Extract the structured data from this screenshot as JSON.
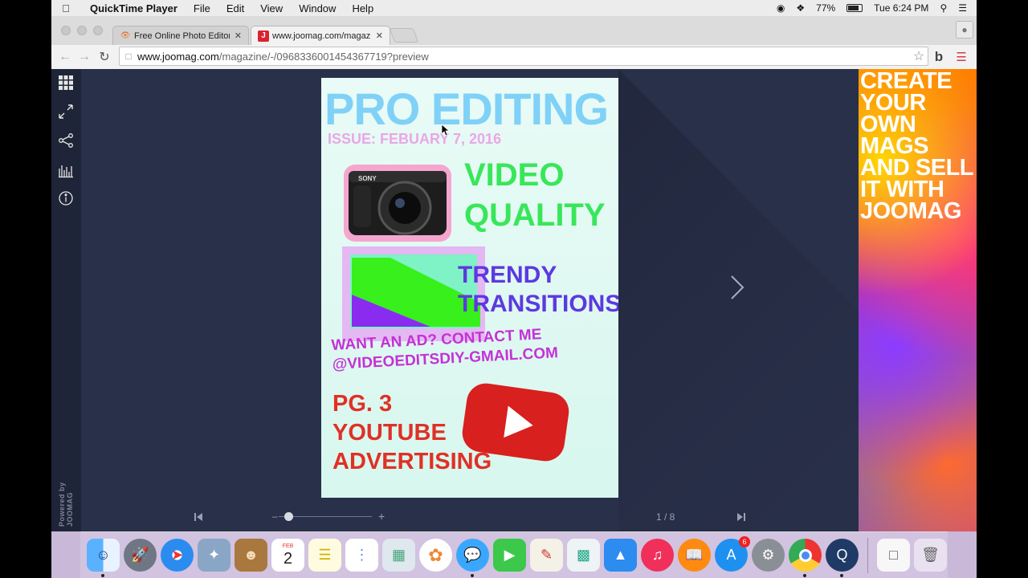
{
  "menubar": {
    "app_name": "QuickTime Player",
    "items": [
      "File",
      "Edit",
      "View",
      "Window",
      "Help"
    ],
    "battery": "77%",
    "clock": "Tue 6:24 PM"
  },
  "browser": {
    "tabs": [
      {
        "title": "Free Online Photo Editor | ("
      },
      {
        "title": "www.joomag.com/magazine/"
      }
    ],
    "url_host": "www.joomag.com",
    "url_path": "/magazine/-/0968336001454367719?preview"
  },
  "magazine": {
    "title": "PRO EDITING",
    "issue": "ISSUE: FEBUARY 7, 2016",
    "video_line1": "VIDEO",
    "video_line2": "QUALITY",
    "trendy_line1": "TRENDY",
    "trendy_line2": "TRANSITIONS",
    "ad_line1": "WANT AN AD? CONTACT ME",
    "ad_line2": "@VIDEOEDITSDIY-GMAIL.COM",
    "pg_line1": "PG. 3",
    "pg_line2": "YOUTUBE",
    "pg_line3": "ADVERTISING",
    "camera_brand": "SONY"
  },
  "viewer": {
    "powered_by": "Powered by JOOMAG",
    "page_counter": "1 / 8",
    "zoom_level": 0.1
  },
  "ad": {
    "text": "CREATE YOUR OWN MAGS AND SELL IT WITH JOOMAG"
  },
  "dock": {
    "calendar_month": "FEB",
    "calendar_day": "2",
    "appstore_badge": "6"
  }
}
